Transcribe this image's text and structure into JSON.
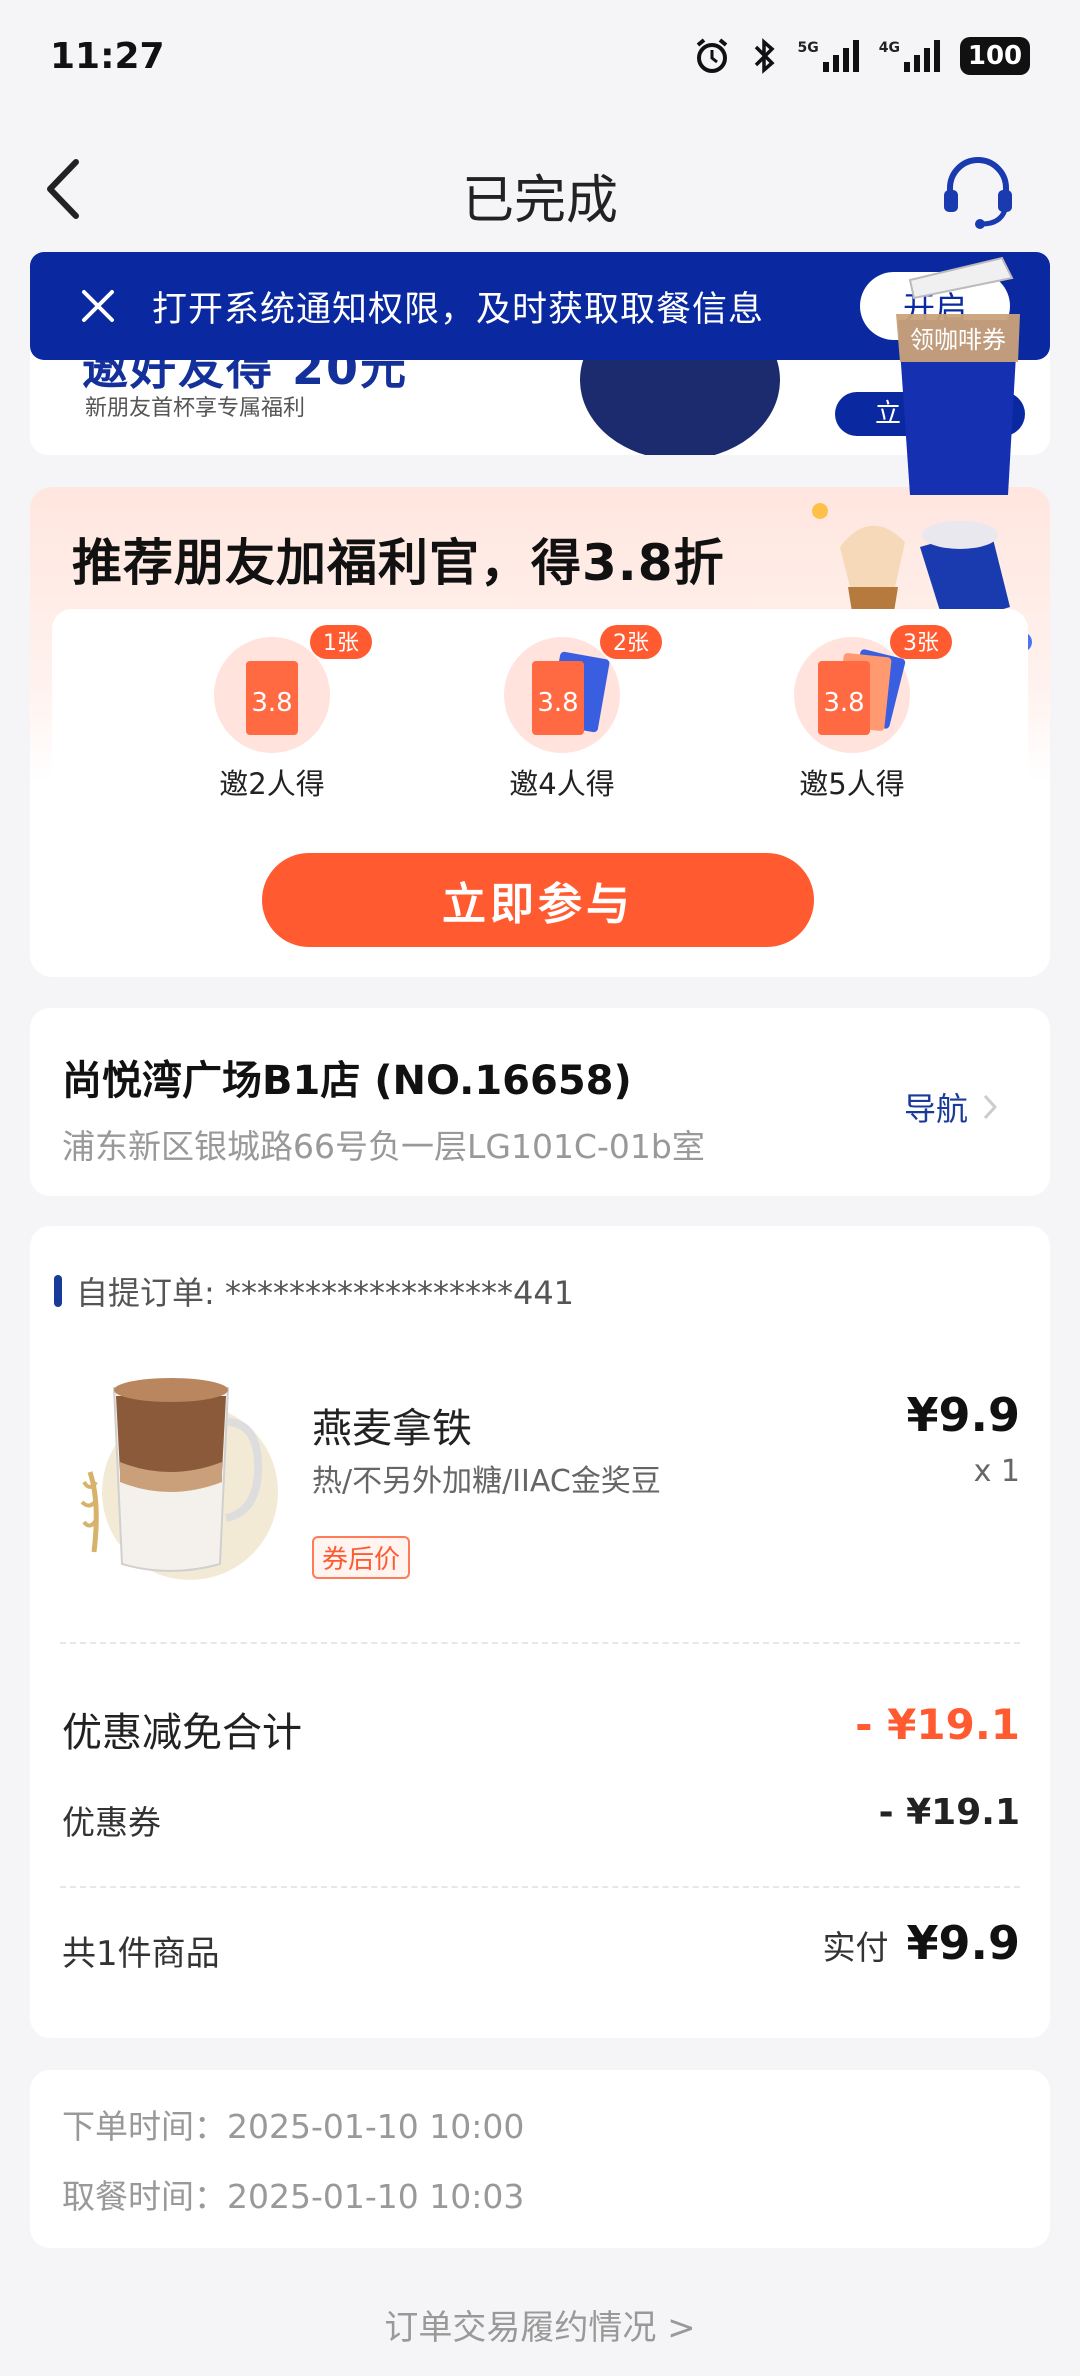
{
  "status_bar": {
    "time": "11:27",
    "net1": "5G",
    "net2": "4G",
    "battery": "100"
  },
  "nav": {
    "title": "已完成"
  },
  "notice": {
    "message": "打开系统通知权限，及时获取取餐信息",
    "button": "开启"
  },
  "promo": {
    "headline": "邀好友得 20元",
    "subtitle": "新朋友首杯享专属福利",
    "cta": "立"
  },
  "coupon_cup": {
    "label": "领咖啡券"
  },
  "referral": {
    "title": "推荐朋友加福利官，得3.8折",
    "tiers": [
      {
        "badge": "1张",
        "ticket_value": "3.8",
        "label": "邀2人得"
      },
      {
        "badge": "2张",
        "ticket_value": "3.8",
        "label": "邀4人得"
      },
      {
        "badge": "3张",
        "ticket_value": "3.8",
        "label": "邀5人得"
      }
    ],
    "button": "立即参与"
  },
  "store": {
    "name": "尚悦湾广场B1店 (NO.16658)",
    "address": "浦东新区银城路66号负一层LG101C-01b室",
    "navigate": "导航"
  },
  "order": {
    "id_label": "自提订单: ******************441",
    "product": {
      "name": "燕麦拿铁",
      "spec": "热/不另外加糖/IIAC金奖豆",
      "tag": "券后价",
      "price": "¥9.9",
      "qty": "x 1"
    },
    "discount_total_label": "优惠减免合计",
    "discount_total_value": "- ¥19.1",
    "coupon_label": "优惠券",
    "coupon_value": "- ¥19.1",
    "count_label": "共1件商品",
    "paid_label": "实付",
    "paid_value": "¥9.9"
  },
  "times": {
    "order_time": "下单时间：2025-01-10 10:00",
    "pickup_time": "取餐时间：2025-01-10 10:03"
  },
  "footer_link": "订单交易履约情况 >",
  "colors": {
    "brand_blue": "#0a28a0",
    "accent_orange": "#ff5a30",
    "background": "#f5f5f7"
  }
}
